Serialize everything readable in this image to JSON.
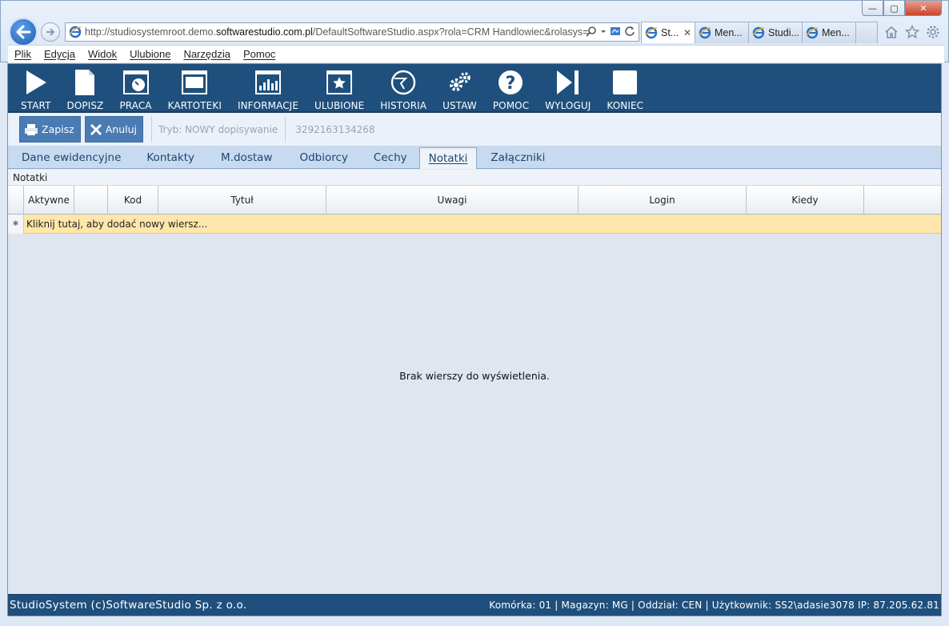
{
  "browser": {
    "window_controls": {
      "minimize": "—",
      "maximize": "▢",
      "close": "✕"
    },
    "address": "http://studiosystemroot.demo.softwarestudio.com.pl/DefaultSoftwareStudio.aspx?rola=CRM Handlowiec&rolasys=CH",
    "address_parts": {
      "prefix": "http://studiosystemroot.demo.",
      "domain": "softwarestudio.com.pl",
      "suffix": "/DefaultSoftwareStudio.aspx?rola=CRM Handlowiec&rolasys=CH"
    },
    "tabs": [
      {
        "label": "St...",
        "active": true
      },
      {
        "label": "Men...",
        "active": false
      },
      {
        "label": "Studi...",
        "active": false
      },
      {
        "label": "Men...",
        "active": false
      }
    ],
    "menu": [
      "Plik",
      "Edycja",
      "Widok",
      "Ulubione",
      "Narzędzia",
      "Pomoc"
    ]
  },
  "toolbar": {
    "items": [
      {
        "label": "START",
        "icon": "play-icon"
      },
      {
        "label": "DOPISZ",
        "icon": "document-icon"
      },
      {
        "label": "PRACA",
        "icon": "gauge-icon"
      },
      {
        "label": "KARTOTEKI",
        "icon": "window-icon"
      },
      {
        "label": "INFORMACJE",
        "icon": "bar-chart-icon"
      },
      {
        "label": "ULUBIONE",
        "icon": "star-window-icon"
      },
      {
        "label": "HISTORIA",
        "icon": "history-icon"
      },
      {
        "label": "USTAW",
        "icon": "gears-icon"
      },
      {
        "label": "POMOC",
        "icon": "question-icon"
      },
      {
        "label": "WYLOGUJ",
        "icon": "skip-icon"
      },
      {
        "label": "KONIEC",
        "icon": "square-icon"
      }
    ]
  },
  "actions": {
    "save_label": "Zapisz",
    "cancel_label": "Anuluj",
    "mode_text": "Tryb: NOWY dopisywanie",
    "doc_number": "3292163134268"
  },
  "tabs": [
    "Dane ewidencyjne",
    "Kontakty",
    "M.dostaw",
    "Odbiorcy",
    "Cechy",
    "Notatki",
    "Załączniki"
  ],
  "active_tab": "Notatki",
  "panel": {
    "title": "Notatki",
    "columns": [
      "",
      "Aktywne",
      "",
      "Kod",
      "Tytuł",
      "Uwagi",
      "Login",
      "Kiedy",
      ""
    ],
    "new_row_text": "Kliknij tutaj, aby dodać nowy wiersz...",
    "empty_text": "Brak wierszy do wyświetlenia."
  },
  "status": {
    "left": "StudioSystem (c)SoftwareStudio Sp. z o.o.",
    "right": "Komórka: 01 | Magazyn: MG | Oddział: CEN | Użytkownik: SS2\\adasie3078 IP: 87.205.62.81"
  },
  "colors": {
    "toolbar_bg": "#1f4f7c",
    "new_row_bg": "#ffe6aa",
    "button_bg": "#4a7bb3"
  }
}
